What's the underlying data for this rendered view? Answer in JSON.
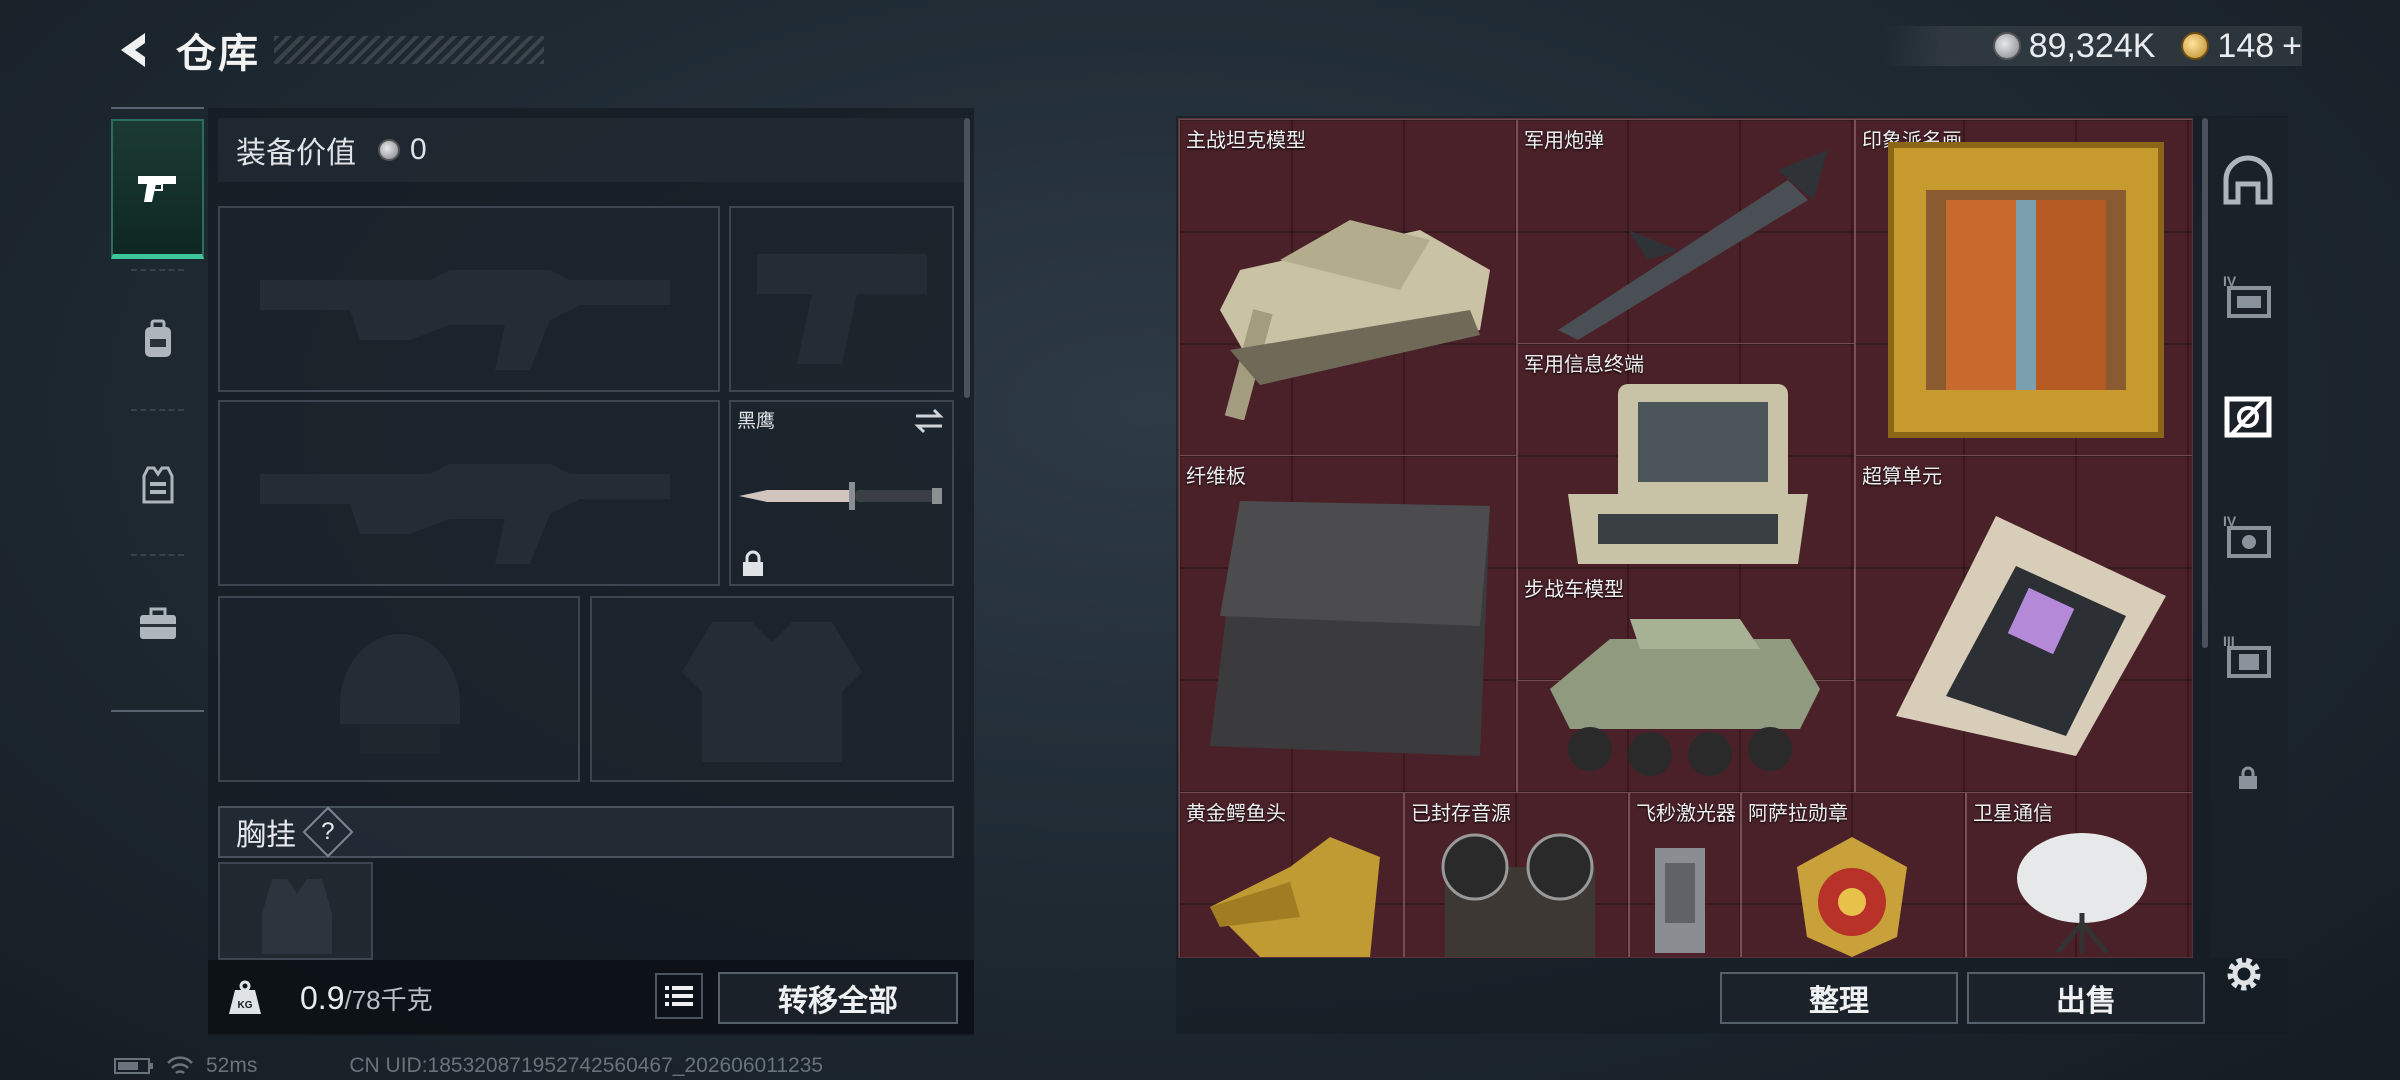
{
  "header": {
    "title": "仓库"
  },
  "currency": {
    "silver": "89,324K",
    "gold": "148",
    "gold_plus": "+"
  },
  "left": {
    "equip_value_label": "装备价值",
    "equip_value": "0",
    "melee_name": "黑鹰",
    "chest_label": "胸挂",
    "chest_help": "?",
    "weight_current": "0.9",
    "weight_max": "/78千克",
    "transfer_all": "转移全部"
  },
  "right": {
    "items": [
      {
        "name": "主战坦克模型"
      },
      {
        "name": "军用炮弹"
      },
      {
        "name": "印象派名画"
      },
      {
        "name": "军用信息终端"
      },
      {
        "name": "纤维板"
      },
      {
        "name": "超算单元"
      },
      {
        "name": "步战车模型"
      },
      {
        "name": "黄金鳄鱼头"
      },
      {
        "name": "已封存音源"
      },
      {
        "name": "飞秒激光器"
      },
      {
        "name": "阿萨拉勋章"
      },
      {
        "name": "卫星通信"
      }
    ],
    "sort_button": "整理",
    "sell_button": "出售"
  },
  "side_categories": [
    "home-storage",
    "storage-IV-a",
    "storage-active",
    "storage-IV-b",
    "storage-III",
    "locked"
  ],
  "status": {
    "ping": "52ms",
    "uid": "CN UID:18532087195274256046​7_202606011235"
  },
  "colors": {
    "accent": "#3fc59a",
    "grid_bg": "#4a2128"
  }
}
